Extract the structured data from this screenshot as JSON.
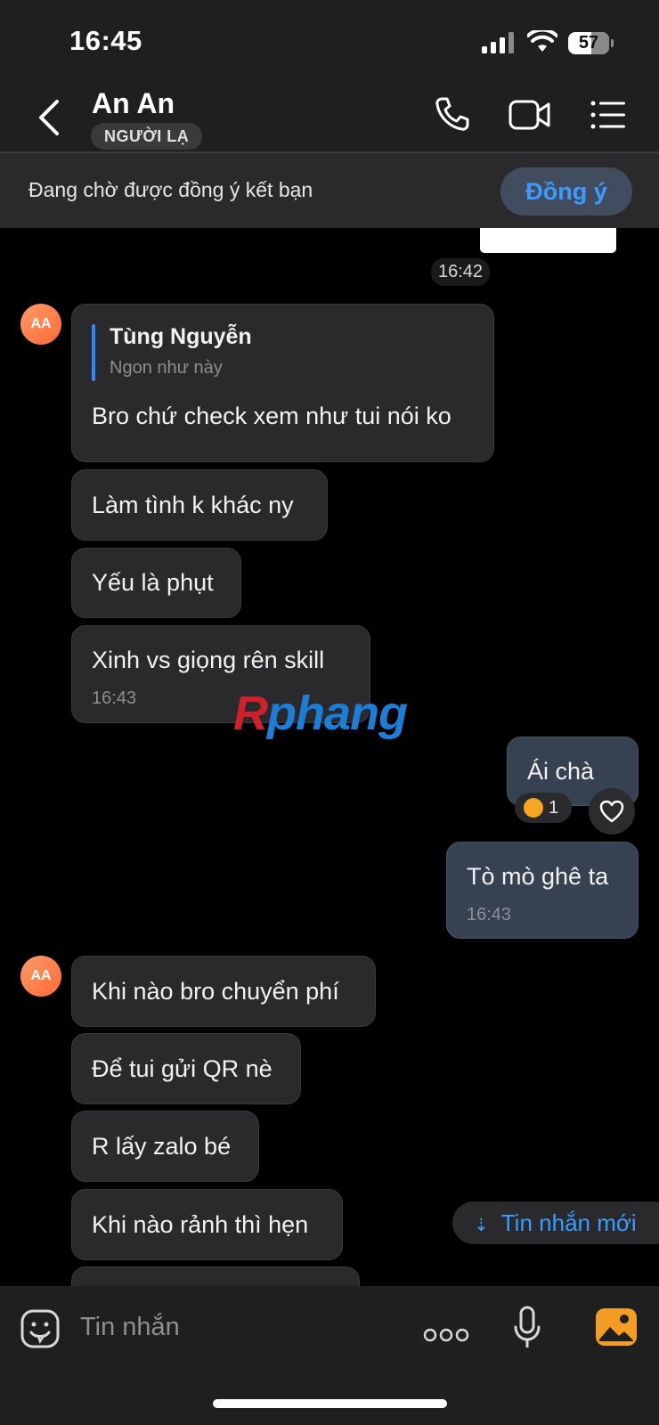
{
  "status": {
    "time": "16:45",
    "battery": "57"
  },
  "header": {
    "name": "An An",
    "badge": "NGƯỜI LẠ"
  },
  "friend_request": {
    "text": "Đang chờ được đồng ý kết bạn",
    "accept_label": "Đồng ý"
  },
  "time_separator": "16:42",
  "messages": {
    "avatar_initials": "AA",
    "quote": {
      "author": "Tùng Nguyễn",
      "text": "Ngon như này",
      "reply": "Bro chứ check xem như tui nói ko"
    },
    "m1": "Làm tình k khác ny",
    "m2": "Yếu là phụt",
    "m3": "Xinh vs giọng rên skill",
    "m3_time": "16:43",
    "mine1": "Ái chà",
    "mine1_reaction_count": "1",
    "mine2": "Tò mò ghê ta",
    "mine2_time": "16:43",
    "m4": "Khi nào bro chuyển phí",
    "m5": "Để tui gửi QR nè",
    "m6": "R lấy zalo bé",
    "m7": "Khi nào rảnh thì hẹn"
  },
  "watermark": {
    "r": "R",
    "rest": "phang"
  },
  "new_messages_label": "Tin nhắn mới",
  "composer": {
    "placeholder": "Tin nhắn"
  },
  "colors": {
    "accent": "#3b9cff",
    "bubble_in": "#2a2a2c",
    "bubble_out": "#364152"
  }
}
